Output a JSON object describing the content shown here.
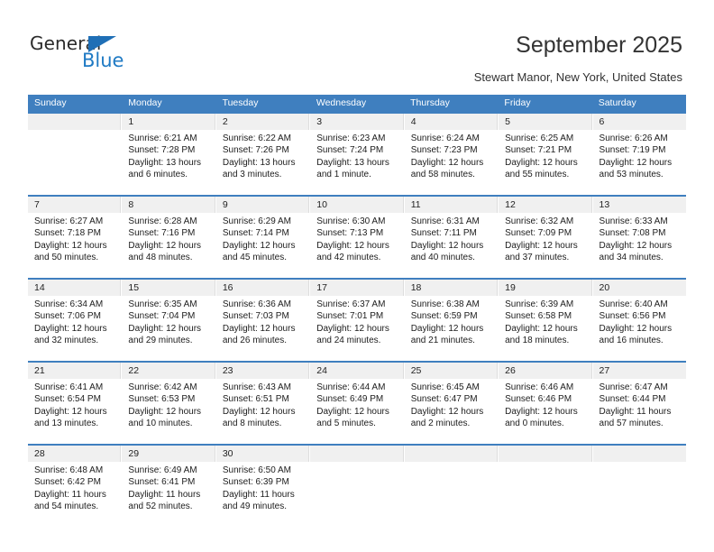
{
  "logo": {
    "general": "General",
    "blue": "Blue",
    "triangle_color": "#1f6fb6",
    "blue_color": "#1f7ac4"
  },
  "header": {
    "title": "September 2025",
    "subtitle": "Stewart Manor, New York, United States"
  },
  "theme": {
    "header_blue": "#3f7fbf",
    "day_band_gray": "#f0f0f0"
  },
  "calendar": {
    "weekdays": [
      "Sunday",
      "Monday",
      "Tuesday",
      "Wednesday",
      "Thursday",
      "Friday",
      "Saturday"
    ],
    "labels": {
      "sunrise": "Sunrise:",
      "sunset": "Sunset:",
      "daylight": "Daylight:"
    },
    "weeks": [
      [
        {
          "day": "",
          "lines": []
        },
        {
          "day": "1",
          "lines": [
            "Sunrise: 6:21 AM",
            "Sunset: 7:28 PM",
            "Daylight: 13 hours",
            "and 6 minutes."
          ]
        },
        {
          "day": "2",
          "lines": [
            "Sunrise: 6:22 AM",
            "Sunset: 7:26 PM",
            "Daylight: 13 hours",
            "and 3 minutes."
          ]
        },
        {
          "day": "3",
          "lines": [
            "Sunrise: 6:23 AM",
            "Sunset: 7:24 PM",
            "Daylight: 13 hours",
            "and 1 minute."
          ]
        },
        {
          "day": "4",
          "lines": [
            "Sunrise: 6:24 AM",
            "Sunset: 7:23 PM",
            "Daylight: 12 hours",
            "and 58 minutes."
          ]
        },
        {
          "day": "5",
          "lines": [
            "Sunrise: 6:25 AM",
            "Sunset: 7:21 PM",
            "Daylight: 12 hours",
            "and 55 minutes."
          ]
        },
        {
          "day": "6",
          "lines": [
            "Sunrise: 6:26 AM",
            "Sunset: 7:19 PM",
            "Daylight: 12 hours",
            "and 53 minutes."
          ]
        }
      ],
      [
        {
          "day": "7",
          "lines": [
            "Sunrise: 6:27 AM",
            "Sunset: 7:18 PM",
            "Daylight: 12 hours",
            "and 50 minutes."
          ]
        },
        {
          "day": "8",
          "lines": [
            "Sunrise: 6:28 AM",
            "Sunset: 7:16 PM",
            "Daylight: 12 hours",
            "and 48 minutes."
          ]
        },
        {
          "day": "9",
          "lines": [
            "Sunrise: 6:29 AM",
            "Sunset: 7:14 PM",
            "Daylight: 12 hours",
            "and 45 minutes."
          ]
        },
        {
          "day": "10",
          "lines": [
            "Sunrise: 6:30 AM",
            "Sunset: 7:13 PM",
            "Daylight: 12 hours",
            "and 42 minutes."
          ]
        },
        {
          "day": "11",
          "lines": [
            "Sunrise: 6:31 AM",
            "Sunset: 7:11 PM",
            "Daylight: 12 hours",
            "and 40 minutes."
          ]
        },
        {
          "day": "12",
          "lines": [
            "Sunrise: 6:32 AM",
            "Sunset: 7:09 PM",
            "Daylight: 12 hours",
            "and 37 minutes."
          ]
        },
        {
          "day": "13",
          "lines": [
            "Sunrise: 6:33 AM",
            "Sunset: 7:08 PM",
            "Daylight: 12 hours",
            "and 34 minutes."
          ]
        }
      ],
      [
        {
          "day": "14",
          "lines": [
            "Sunrise: 6:34 AM",
            "Sunset: 7:06 PM",
            "Daylight: 12 hours",
            "and 32 minutes."
          ]
        },
        {
          "day": "15",
          "lines": [
            "Sunrise: 6:35 AM",
            "Sunset: 7:04 PM",
            "Daylight: 12 hours",
            "and 29 minutes."
          ]
        },
        {
          "day": "16",
          "lines": [
            "Sunrise: 6:36 AM",
            "Sunset: 7:03 PM",
            "Daylight: 12 hours",
            "and 26 minutes."
          ]
        },
        {
          "day": "17",
          "lines": [
            "Sunrise: 6:37 AM",
            "Sunset: 7:01 PM",
            "Daylight: 12 hours",
            "and 24 minutes."
          ]
        },
        {
          "day": "18",
          "lines": [
            "Sunrise: 6:38 AM",
            "Sunset: 6:59 PM",
            "Daylight: 12 hours",
            "and 21 minutes."
          ]
        },
        {
          "day": "19",
          "lines": [
            "Sunrise: 6:39 AM",
            "Sunset: 6:58 PM",
            "Daylight: 12 hours",
            "and 18 minutes."
          ]
        },
        {
          "day": "20",
          "lines": [
            "Sunrise: 6:40 AM",
            "Sunset: 6:56 PM",
            "Daylight: 12 hours",
            "and 16 minutes."
          ]
        }
      ],
      [
        {
          "day": "21",
          "lines": [
            "Sunrise: 6:41 AM",
            "Sunset: 6:54 PM",
            "Daylight: 12 hours",
            "and 13 minutes."
          ]
        },
        {
          "day": "22",
          "lines": [
            "Sunrise: 6:42 AM",
            "Sunset: 6:53 PM",
            "Daylight: 12 hours",
            "and 10 minutes."
          ]
        },
        {
          "day": "23",
          "lines": [
            "Sunrise: 6:43 AM",
            "Sunset: 6:51 PM",
            "Daylight: 12 hours",
            "and 8 minutes."
          ]
        },
        {
          "day": "24",
          "lines": [
            "Sunrise: 6:44 AM",
            "Sunset: 6:49 PM",
            "Daylight: 12 hours",
            "and 5 minutes."
          ]
        },
        {
          "day": "25",
          "lines": [
            "Sunrise: 6:45 AM",
            "Sunset: 6:47 PM",
            "Daylight: 12 hours",
            "and 2 minutes."
          ]
        },
        {
          "day": "26",
          "lines": [
            "Sunrise: 6:46 AM",
            "Sunset: 6:46 PM",
            "Daylight: 12 hours",
            "and 0 minutes."
          ]
        },
        {
          "day": "27",
          "lines": [
            "Sunrise: 6:47 AM",
            "Sunset: 6:44 PM",
            "Daylight: 11 hours",
            "and 57 minutes."
          ]
        }
      ],
      [
        {
          "day": "28",
          "lines": [
            "Sunrise: 6:48 AM",
            "Sunset: 6:42 PM",
            "Daylight: 11 hours",
            "and 54 minutes."
          ]
        },
        {
          "day": "29",
          "lines": [
            "Sunrise: 6:49 AM",
            "Sunset: 6:41 PM",
            "Daylight: 11 hours",
            "and 52 minutes."
          ]
        },
        {
          "day": "30",
          "lines": [
            "Sunrise: 6:50 AM",
            "Sunset: 6:39 PM",
            "Daylight: 11 hours",
            "and 49 minutes."
          ]
        },
        {
          "day": "",
          "lines": []
        },
        {
          "day": "",
          "lines": []
        },
        {
          "day": "",
          "lines": []
        },
        {
          "day": "",
          "lines": []
        }
      ]
    ]
  }
}
